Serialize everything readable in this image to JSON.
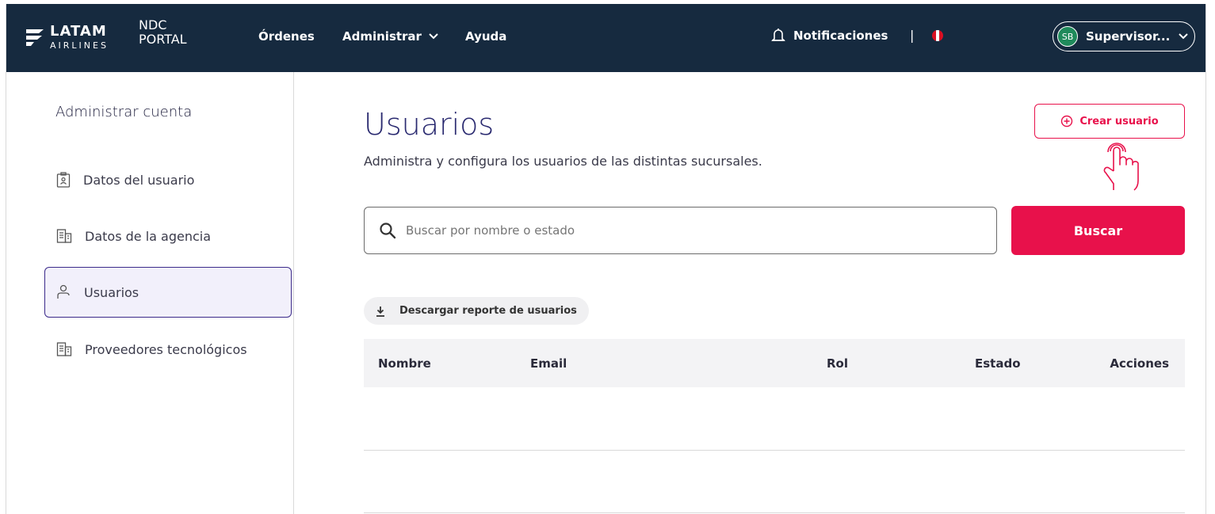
{
  "header": {
    "logo_brand": "LATAM",
    "logo_sub": "AIRLINES",
    "portal_line1": "NDC",
    "portal_line2": "PORTAL",
    "nav": [
      {
        "label": "Órdenes"
      },
      {
        "label": "Administrar"
      },
      {
        "label": "Ayuda"
      }
    ],
    "notifications_label": "Notificaciones",
    "separator": "|",
    "user_initials": "SB",
    "user_name": "Supervisor..."
  },
  "sidebar": {
    "title": "Administrar cuenta",
    "items": [
      {
        "label": "Datos del usuario",
        "icon": "id-badge-icon"
      },
      {
        "label": "Datos de la agencia",
        "icon": "building-icon"
      },
      {
        "label": "Usuarios",
        "icon": "user-icon",
        "active": true
      },
      {
        "label": "Proveedores tecnológicos",
        "icon": "building-icon"
      }
    ]
  },
  "main": {
    "title": "Usuarios",
    "subtitle": "Administra y configura los usuarios de las distintas sucursales.",
    "create_button": "Crear usuario",
    "search_placeholder": "Buscar por nombre o estado",
    "search_button": "Buscar",
    "download_label": "Descargar reporte de usuarios",
    "table_headers": [
      "Nombre",
      "Email",
      "Rol",
      "Estado",
      "Acciones"
    ]
  },
  "colors": {
    "header_bg": "#162a3f",
    "accent": "#e8114b",
    "title": "#2a2a70"
  }
}
